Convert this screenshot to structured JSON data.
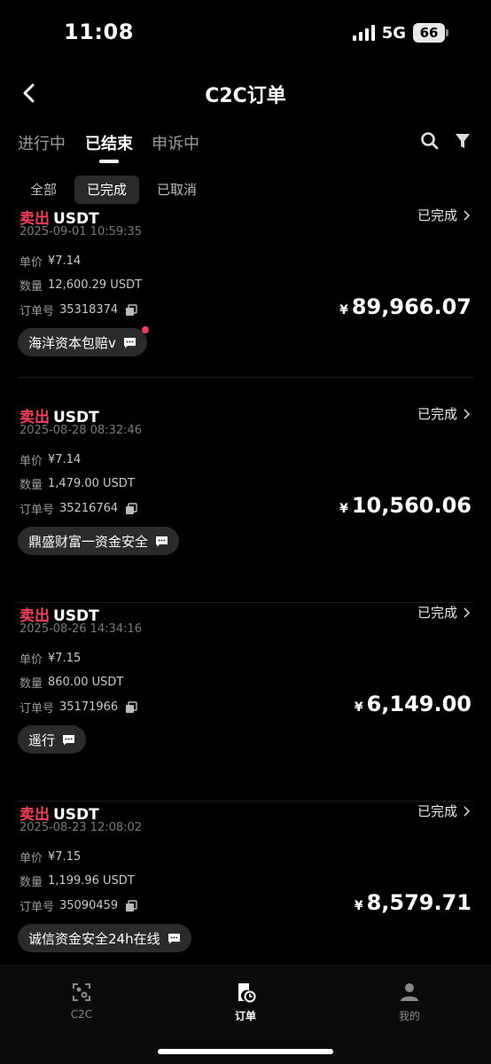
{
  "status_bar": {
    "time": "11:08",
    "network": "5G",
    "battery": "66"
  },
  "header": {
    "title": "C2C订单",
    "back_icon": "chevron-left-icon"
  },
  "main_tabs": [
    {
      "label": "进行中"
    },
    {
      "label": "已结束"
    },
    {
      "label": "申诉中"
    }
  ],
  "main_tab_active": "已结束",
  "icons": {
    "search": "search-icon",
    "filter": "filter-icon",
    "copy": "copy-icon",
    "chat": "chat-icon"
  },
  "sub_tabs": [
    {
      "label": "全部"
    },
    {
      "label": "已完成"
    },
    {
      "label": "已取消"
    }
  ],
  "sub_tab_active": "已完成",
  "labels": {
    "unit_price": "单价",
    "quantity": "数量",
    "order_no": "订单号",
    "currency": "¥"
  },
  "orders": [
    {
      "side": "卖出",
      "coin": "USDT",
      "status": "已完成",
      "time": "2025-09-01 10:59:35",
      "price": "¥7.14",
      "quantity": "12,600.29 USDT",
      "order_no": "35318374",
      "amount": "89,966.07",
      "chat": "海洋资本包赔v",
      "unread": true
    },
    {
      "side": "卖出",
      "coin": "USDT",
      "status": "已完成",
      "time": "2025-08-28 08:32:46",
      "price": "¥7.14",
      "quantity": "1,479.00 USDT",
      "order_no": "35216764",
      "amount": "10,560.06",
      "chat": "鼎盛财富一资金安全",
      "unread": false
    },
    {
      "side": "卖出",
      "coin": "USDT",
      "status": "已完成",
      "time": "2025-08-26 14:34:16",
      "price": "¥7.15",
      "quantity": "860.00 USDT",
      "order_no": "35171966",
      "amount": "6,149.00",
      "chat": "遥行",
      "unread": false
    },
    {
      "side": "卖出",
      "coin": "USDT",
      "status": "已完成",
      "time": "2025-08-23 12:08:02",
      "price": "¥7.15",
      "quantity": "1,199.96 USDT",
      "order_no": "35090459",
      "amount": "8,579.71",
      "chat": "诚信资金安全24h在线",
      "unread": false
    }
  ],
  "bottom_nav": [
    {
      "label": "C2C",
      "icon": "c2c-icon"
    },
    {
      "label": "订单",
      "icon": "orders-icon"
    },
    {
      "label": "我的",
      "icon": "profile-icon"
    }
  ],
  "bottom_nav_active": "订单",
  "colors": {
    "sell": "#f0405b",
    "background": "#000000",
    "chip": "#2b2b2b"
  }
}
